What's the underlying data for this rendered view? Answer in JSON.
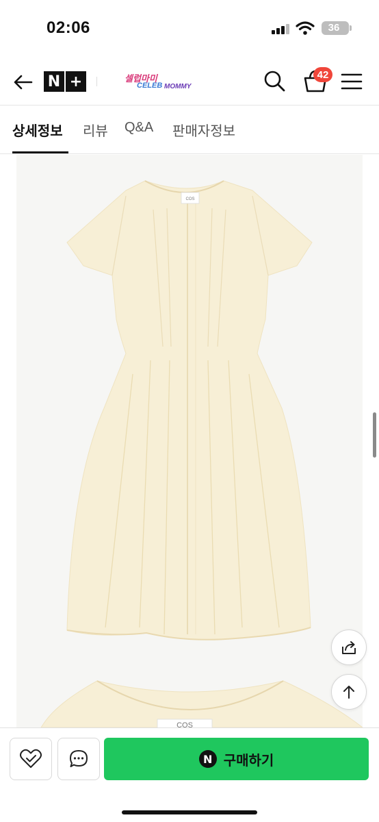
{
  "status_bar": {
    "time": "02:06",
    "battery": "36",
    "icons": [
      "signal-icon",
      "wifi-icon",
      "battery-icon"
    ]
  },
  "header": {
    "brand_badge": [
      "N",
      "+"
    ],
    "store_logo": {
      "line1": "셀럽마미",
      "line2": "CELEB",
      "line3": "MOMMY"
    },
    "cart_count": "42",
    "icons": [
      "back-arrow-icon",
      "search-icon",
      "cart-icon",
      "menu-icon"
    ]
  },
  "tabs": [
    {
      "label": "상세정보",
      "active": true
    },
    {
      "label": "리뷰",
      "active": false
    },
    {
      "label": "Q&A",
      "active": false
    },
    {
      "label": "판매자정보",
      "active": false
    }
  ],
  "product": {
    "label_text": "COS",
    "label_text_2": "COS",
    "dress_color": "#f7efd6"
  },
  "floating": {
    "icons": [
      "share-icon",
      "arrow-up-icon"
    ]
  },
  "bottom_bar": {
    "buy_icon_letter": "N",
    "buy_label": "구매하기",
    "buy_color": "#1fc75e",
    "icons": [
      "heart-check-icon",
      "chat-icon"
    ]
  }
}
